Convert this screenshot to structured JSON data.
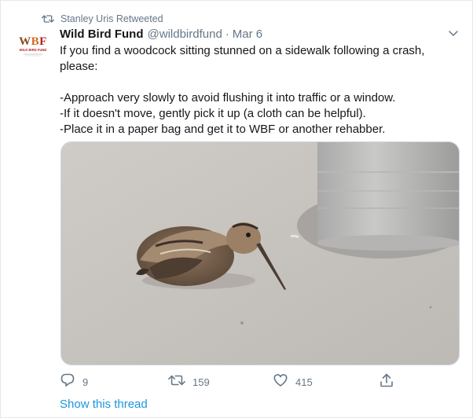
{
  "social_context": {
    "icon": "retweet-icon",
    "text": "Stanley Uris Retweeted"
  },
  "author": {
    "avatar_text": "WBF",
    "avatar_subtext": "WILD BIRD FUND",
    "name": "Wild Bird Fund",
    "handle": "@wildbirdfund",
    "separator": "·",
    "date": "Mar 6"
  },
  "tweet": {
    "line1": "If you find a woodcock sitting stunned on a sidewalk following a crash,",
    "line2": "please:",
    "bullet1": "-Approach very slowly to avoid flushing it into traffic or a window.",
    "bullet2": "-If it doesn't move, gently pick it up (a cloth can be helpful).",
    "bullet3": "-Place it in a paper bag and get it to WBF or another rehabber."
  },
  "actions": {
    "reply_count": "9",
    "retweet_count": "159",
    "like_count": "415"
  },
  "links": {
    "show_thread": "Show this thread"
  },
  "colors": {
    "text_primary": "#14171a",
    "text_secondary": "#657786",
    "link": "#1b95e0",
    "border": "#e1e8ed"
  }
}
